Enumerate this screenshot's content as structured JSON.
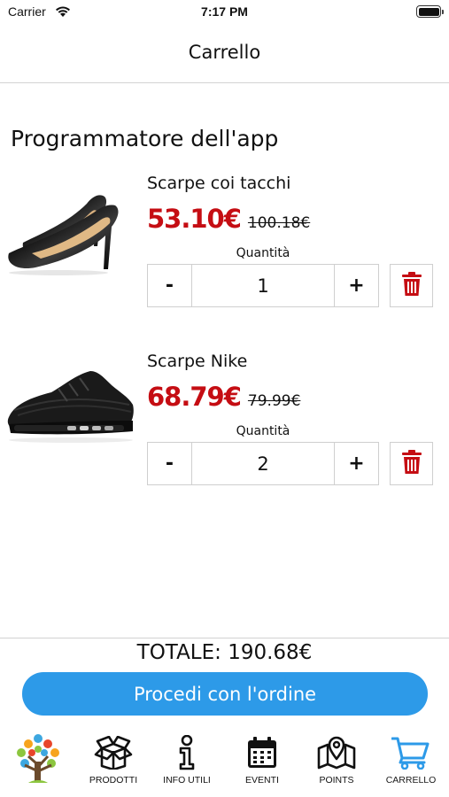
{
  "status_bar": {
    "carrier": "Carrier",
    "time": "7:17 PM"
  },
  "header": {
    "title": "Carrello"
  },
  "cart": {
    "seller_name": "Programmatore dell'app",
    "quantity_label": "Quantità",
    "items": [
      {
        "name": "Scarpe coi tacchi",
        "price": "53.10€",
        "old_price": "100.18€",
        "quantity": "1",
        "image": "black-heels-photo"
      },
      {
        "name": "Scarpe Nike",
        "price": "68.79€",
        "old_price": "79.99€",
        "quantity": "2",
        "image": "black-sneaker-photo"
      }
    ],
    "minus_label": "-",
    "plus_label": "+"
  },
  "footer": {
    "total": "TOTALE: 190.68€",
    "checkout_label": "Procedi con l'ordine"
  },
  "tab_bar": {
    "items": [
      {
        "label": "PRODOTTI",
        "icon": "box-open-icon"
      },
      {
        "label": "INFO UTILI",
        "icon": "info-icon"
      },
      {
        "label": "EVENTI",
        "icon": "calendar-icon"
      },
      {
        "label": "POINTS",
        "icon": "map-marker-icon"
      },
      {
        "label": "CARRELLO",
        "icon": "shopping-cart-icon"
      }
    ],
    "active_index": 4
  },
  "colors": {
    "price": "#c50d13",
    "accent": "#2d9ae8",
    "delete": "#c50d13",
    "active_tab": "#2d9ae8"
  }
}
